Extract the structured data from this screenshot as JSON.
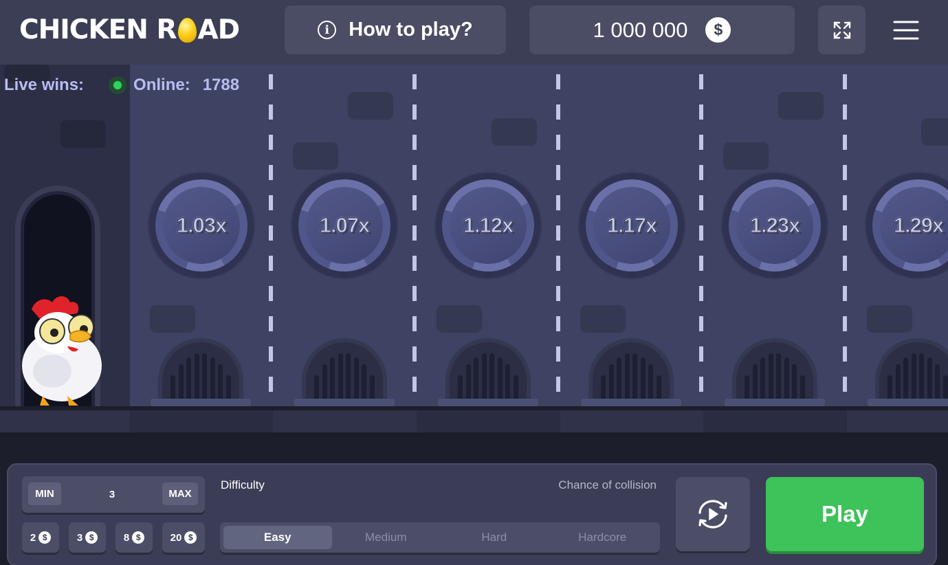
{
  "header": {
    "logo_left": "CHICKEN R",
    "logo_right": "AD",
    "how_to_play": "How to play?",
    "balance": "1 000 000",
    "currency_symbol": "$",
    "icons": [
      "info-icon",
      "dollar-coin-icon",
      "fullscreen-icon",
      "hamburger-menu-icon"
    ]
  },
  "live": {
    "live_wins_label": "Live wins:",
    "online_label": "Online:",
    "online_count": "1788",
    "online_dot_color": "#32d25a"
  },
  "lanes": [
    {
      "multiplier": "1.03x"
    },
    {
      "multiplier": "1.07x"
    },
    {
      "multiplier": "1.12x"
    },
    {
      "multiplier": "1.17x"
    },
    {
      "multiplier": "1.23x"
    },
    {
      "multiplier": "1.29x"
    }
  ],
  "controls": {
    "min_label": "MIN",
    "max_label": "MAX",
    "bet_value": "3",
    "quick_bets": [
      {
        "value": "2",
        "symbol": "$"
      },
      {
        "value": "3",
        "symbol": "$"
      },
      {
        "value": "8",
        "symbol": "$"
      },
      {
        "value": "20",
        "symbol": "$"
      }
    ],
    "difficulty_label": "Difficulty",
    "chance_label": "Chance of collision",
    "difficulties": [
      "Easy",
      "Medium",
      "Hard",
      "Hardcore"
    ],
    "selected_difficulty": "Easy",
    "play_label": "Play",
    "autoplay_icon": "autoplay-icon",
    "play_color": "#3ec25a"
  },
  "colors": {
    "header_bg": "#3b3e54",
    "game_bg": "#3e4263",
    "accent_egg": "#ffd21f"
  }
}
